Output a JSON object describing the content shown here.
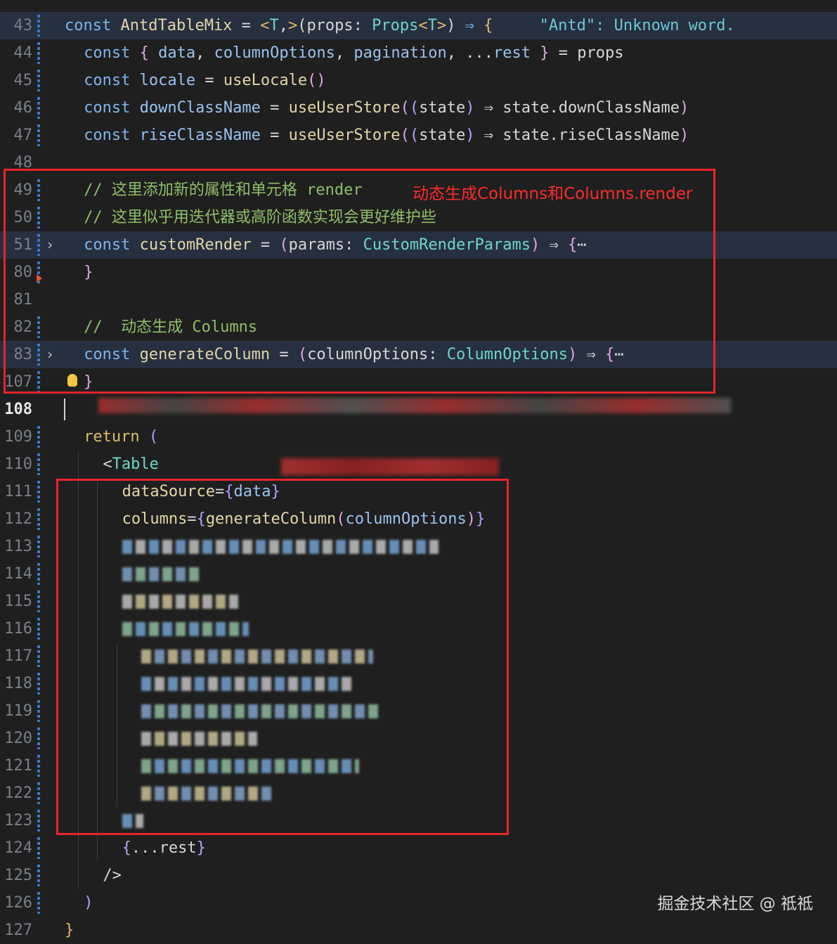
{
  "lines": [
    {
      "n": "43",
      "tokens": [
        [
          "kw",
          "const "
        ],
        [
          "fn",
          "AntdTableMix"
        ],
        [
          "pn",
          " = "
        ],
        [
          "str",
          "<"
        ],
        [
          "ty",
          "T"
        ],
        [
          "pn",
          ","
        ],
        [
          "str",
          ">"
        ],
        [
          "pn",
          "("
        ],
        [
          "var",
          "props"
        ],
        [
          "pn",
          ": "
        ],
        [
          "ty",
          "Props"
        ],
        [
          "str",
          "<"
        ],
        [
          "ty",
          "T"
        ],
        [
          "str",
          ">"
        ],
        [
          "pn",
          ") "
        ],
        [
          "kw",
          "⇒ "
        ],
        [
          "str",
          "{"
        ],
        [
          "pn",
          "     "
        ],
        [
          "warn",
          "\"Antd\": Unknown word."
        ]
      ]
    },
    {
      "n": "44",
      "tokens": [
        [
          "kw",
          "const "
        ],
        [
          "br",
          "{ "
        ],
        [
          "id",
          "data"
        ],
        [
          "pn",
          ", "
        ],
        [
          "id",
          "columnOptions"
        ],
        [
          "pn",
          ", "
        ],
        [
          "id",
          "pagination"
        ],
        [
          "pn",
          ", ..."
        ],
        [
          "id",
          "rest"
        ],
        [
          "br",
          " }"
        ],
        [
          "pn",
          " = "
        ],
        [
          "var",
          "props"
        ]
      ]
    },
    {
      "n": "45",
      "tokens": [
        [
          "kw",
          "const "
        ],
        [
          "id",
          "locale"
        ],
        [
          "pn",
          " = "
        ],
        [
          "fn",
          "useLocale"
        ],
        [
          "br",
          "()"
        ]
      ]
    },
    {
      "n": "46",
      "tokens": [
        [
          "kw",
          "const "
        ],
        [
          "id",
          "downClassName"
        ],
        [
          "pn",
          " = "
        ],
        [
          "fn",
          "useUserStore"
        ],
        [
          "br",
          "("
        ],
        [
          "br2",
          "("
        ],
        [
          "var",
          "state"
        ],
        [
          "br2",
          ")"
        ],
        [
          "pn",
          " ⇒ "
        ],
        [
          "var",
          "state.downClassName"
        ],
        [
          "br",
          ")"
        ]
      ]
    },
    {
      "n": "47",
      "tokens": [
        [
          "kw",
          "const "
        ],
        [
          "id",
          "riseClassName"
        ],
        [
          "pn",
          " = "
        ],
        [
          "fn",
          "useUserStore"
        ],
        [
          "br",
          "("
        ],
        [
          "br2",
          "("
        ],
        [
          "var",
          "state"
        ],
        [
          "br2",
          ")"
        ],
        [
          "pn",
          " ⇒ "
        ],
        [
          "var",
          "state.riseClassName"
        ],
        [
          "br",
          ")"
        ]
      ]
    },
    {
      "n": "48",
      "tokens": []
    },
    {
      "n": "49",
      "tokens": [
        [
          "cm",
          "// 这里添加新的属性和单元格 render"
        ]
      ]
    },
    {
      "n": "50",
      "tokens": [
        [
          "cm",
          "// 这里似乎用迭代器或高阶函数实现会更好维护些"
        ]
      ]
    },
    {
      "n": "51",
      "tokens": [
        [
          "kw",
          "const "
        ],
        [
          "fn",
          "customRender"
        ],
        [
          "pn",
          " = "
        ],
        [
          "br",
          "("
        ],
        [
          "var",
          "params"
        ],
        [
          "pn",
          ": "
        ],
        [
          "ty",
          "CustomRenderParams"
        ],
        [
          "br",
          ")"
        ],
        [
          "pn",
          " ⇒ "
        ],
        [
          "br",
          "{"
        ],
        [
          "pn",
          "⋯"
        ]
      ]
    },
    {
      "n": "80",
      "tokens": [
        [
          "br",
          "}"
        ]
      ]
    },
    {
      "n": "81",
      "tokens": []
    },
    {
      "n": "82",
      "tokens": [
        [
          "cm",
          "//  动态生成 Columns"
        ]
      ]
    },
    {
      "n": "83",
      "tokens": [
        [
          "kw",
          "const "
        ],
        [
          "fn",
          "generateColumn"
        ],
        [
          "pn",
          " = "
        ],
        [
          "br",
          "("
        ],
        [
          "var",
          "columnOptions"
        ],
        [
          "pn",
          ": "
        ],
        [
          "ty",
          "ColumnOptions"
        ],
        [
          "br",
          ")"
        ],
        [
          "pn",
          " ⇒ "
        ],
        [
          "br",
          "{"
        ],
        [
          "pn",
          "⋯"
        ]
      ]
    },
    {
      "n": "107",
      "tokens": [
        [
          "br",
          "}"
        ]
      ]
    },
    {
      "n": "108",
      "tokens": []
    },
    {
      "n": "109",
      "tokens": [
        [
          "str",
          "return "
        ],
        [
          "br2",
          "("
        ]
      ]
    },
    {
      "n": "110",
      "tokens": [
        [
          "pn",
          "<"
        ],
        [
          "ty",
          "Table"
        ]
      ]
    },
    {
      "n": "111",
      "tokens": [
        [
          "attr",
          "dataSource"
        ],
        [
          "pn",
          "="
        ],
        [
          "br2",
          "{"
        ],
        [
          "id",
          "data"
        ],
        [
          "br2",
          "}"
        ]
      ]
    },
    {
      "n": "112",
      "tokens": [
        [
          "attr",
          "columns"
        ],
        [
          "pn",
          "="
        ],
        [
          "br2",
          "{"
        ],
        [
          "fn",
          "generateColumn"
        ],
        [
          "br",
          "("
        ],
        [
          "id",
          "columnOptions"
        ],
        [
          "br",
          ")"
        ],
        [
          "br2",
          "}"
        ]
      ]
    },
    {
      "n": "113",
      "tokens": []
    },
    {
      "n": "114",
      "tokens": []
    },
    {
      "n": "115",
      "tokens": []
    },
    {
      "n": "116",
      "tokens": []
    },
    {
      "n": "117",
      "tokens": []
    },
    {
      "n": "118",
      "tokens": []
    },
    {
      "n": "119",
      "tokens": []
    },
    {
      "n": "120",
      "tokens": []
    },
    {
      "n": "121",
      "tokens": []
    },
    {
      "n": "122",
      "tokens": []
    },
    {
      "n": "123",
      "tokens": []
    },
    {
      "n": "124",
      "tokens": [
        [
          "br2",
          "{"
        ],
        [
          "pn",
          "..."
        ],
        [
          "var",
          "rest"
        ],
        [
          "br2",
          "}"
        ]
      ]
    },
    {
      "n": "125",
      "tokens": [
        [
          "pn",
          "/>"
        ]
      ]
    },
    {
      "n": "126",
      "tokens": [
        [
          "br2",
          ")"
        ]
      ]
    },
    {
      "n": "127",
      "tokens": [
        [
          "str",
          "}"
        ]
      ]
    }
  ],
  "annotations": {
    "top": "动态生成Columns和Columns.render"
  },
  "watermark": "掘金技术社区 @ 祗祗",
  "colors": {
    "background": "#1f1f1f",
    "highlight_row": "#263040",
    "red_box": "#e8242b"
  }
}
